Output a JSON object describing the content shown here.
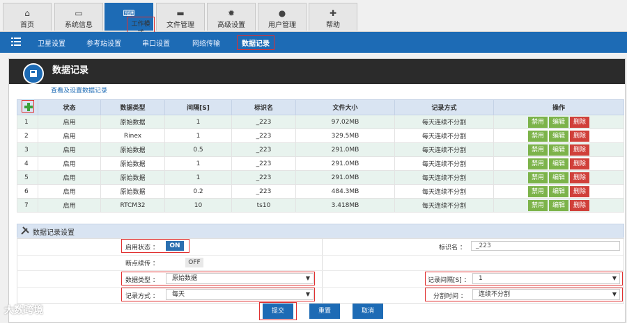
{
  "top_tabs": [
    {
      "label": "首页",
      "icon": "home-icon"
    },
    {
      "label": "系统信息",
      "icon": "monitor-icon"
    },
    {
      "label": "工作模式",
      "icon": "keyboard-icon"
    },
    {
      "label": "文件管理",
      "icon": "folder-icon"
    },
    {
      "label": "高级设置",
      "icon": "gear-icon"
    },
    {
      "label": "用户管理",
      "icon": "user-icon"
    },
    {
      "label": "帮助",
      "icon": "medkit-icon"
    }
  ],
  "sub_tabs": [
    "卫星设置",
    "参考站设置",
    "串口设置",
    "网络传输",
    "数据记录"
  ],
  "panel": {
    "title": "数据记录",
    "subtitle": "查看及设置数据记录"
  },
  "table": {
    "headers": [
      "状态",
      "数据类型",
      "间隔[S]",
      "标识名",
      "文件大小",
      "记录方式",
      "操作"
    ],
    "rows": [
      [
        "1",
        "启用",
        "原始数据",
        "1",
        "_223",
        "97.02MB",
        "每天连续不分割"
      ],
      [
        "2",
        "启用",
        "Rinex",
        "1",
        "_223",
        "329.5MB",
        "每天连续不分割"
      ],
      [
        "3",
        "启用",
        "原始数据",
        "0.5",
        "_223",
        "291.0MB",
        "每天连续不分割"
      ],
      [
        "4",
        "启用",
        "原始数据",
        "1",
        "_223",
        "291.0MB",
        "每天连续不分割"
      ],
      [
        "5",
        "启用",
        "原始数据",
        "1",
        "_223",
        "291.0MB",
        "每天连续不分割"
      ],
      [
        "6",
        "启用",
        "原始数据",
        "0.2",
        "_223",
        "484.3MB",
        "每天连续不分割"
      ],
      [
        "7",
        "启用",
        "RTCM32",
        "10",
        "ts10",
        "3.418MB",
        "每天连续不分割"
      ]
    ],
    "actions": [
      "禁用",
      "编辑",
      "删除"
    ]
  },
  "settings": {
    "title": "数据记录设置",
    "enable_label": "启用状态 ：",
    "enable_value": "ON",
    "resume_label": "断点续传 ：",
    "resume_value": "OFF",
    "datatype_label": "数据类型 ：",
    "datatype_value": "原始数据",
    "mode_label": "记录方式 ：",
    "mode_value": "每天",
    "id_label": "标识名 ：",
    "id_value": "_223",
    "interval_label": "记录间隔[S] ：",
    "interval_value": "1",
    "split_label": "分割时间 ：",
    "split_value": "连续不分割"
  },
  "buttons": {
    "submit": "提交",
    "reset": "重置",
    "cancel": "取消"
  },
  "watermark": "大数跨境"
}
